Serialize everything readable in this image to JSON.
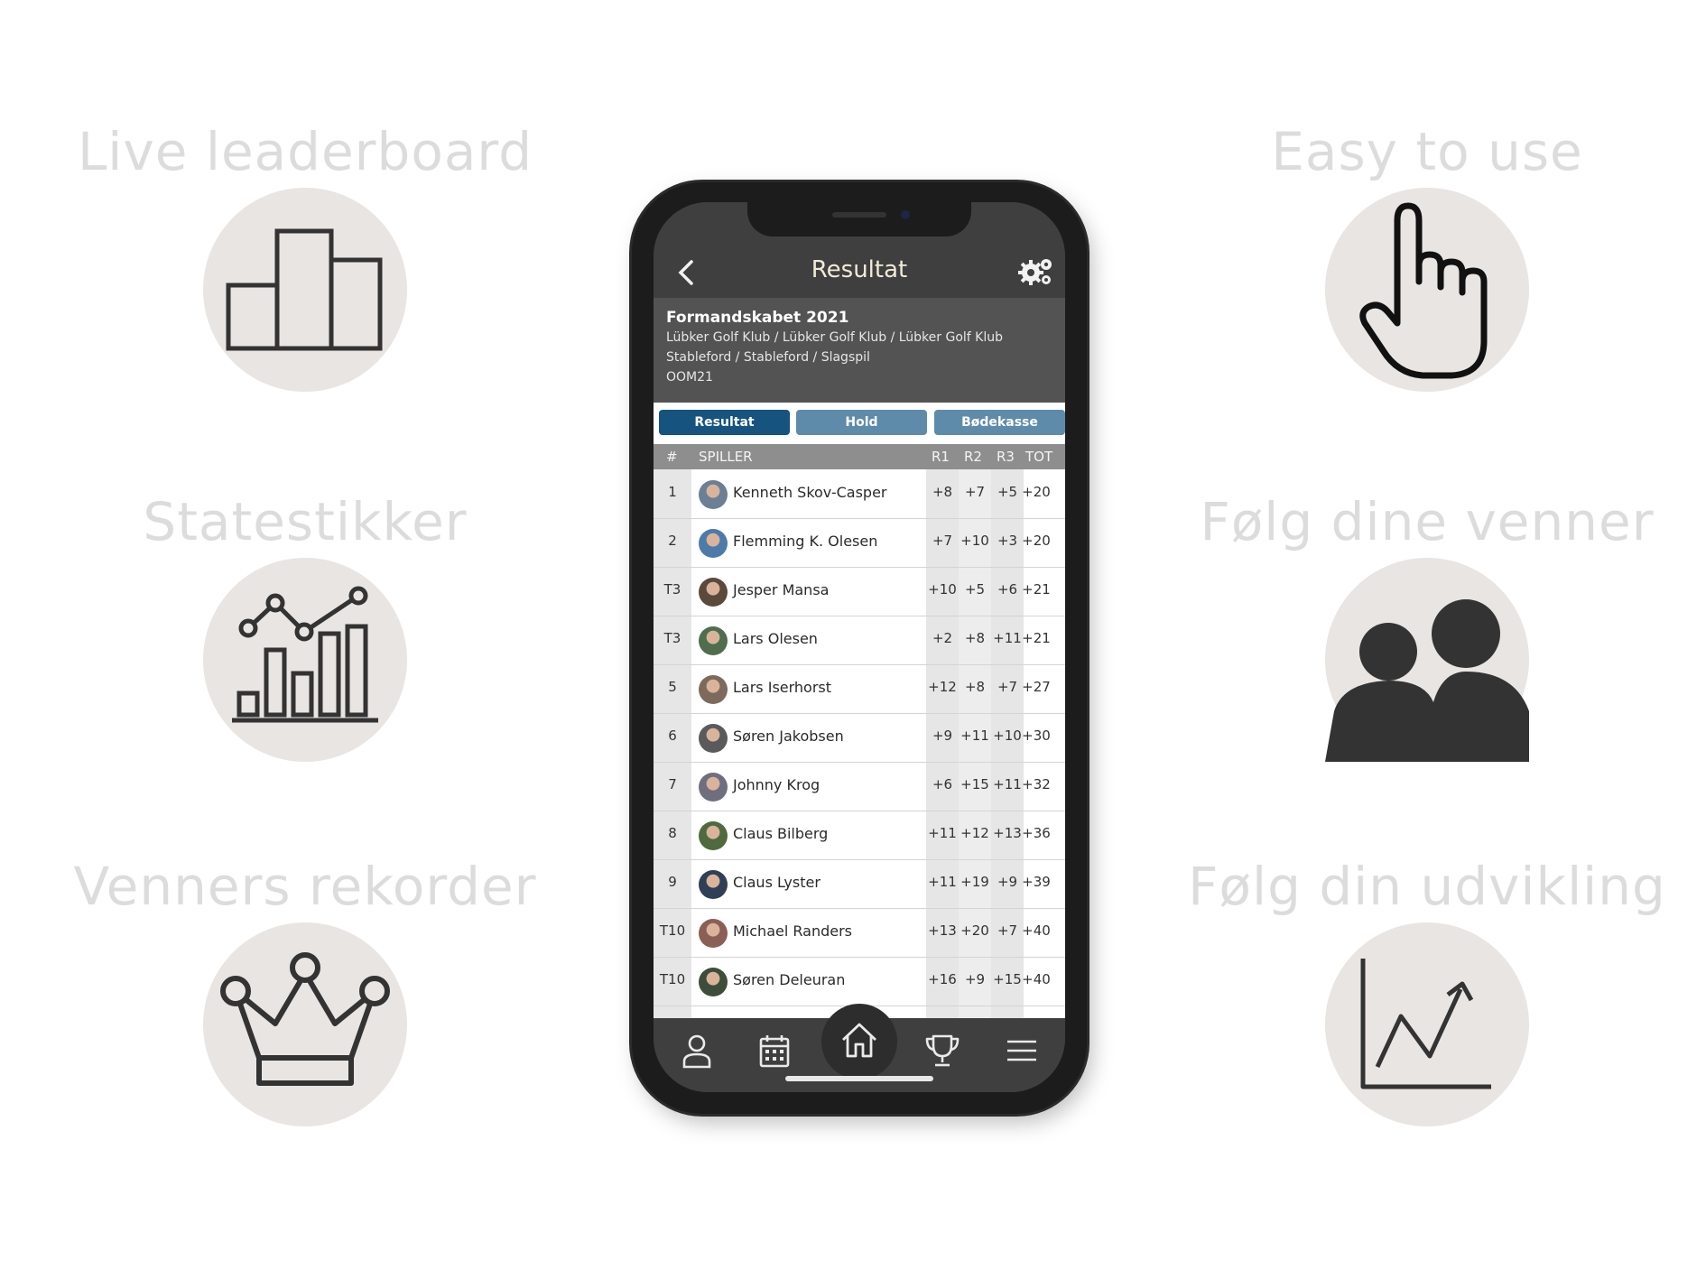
{
  "features": {
    "left": [
      {
        "title": "Live leaderboard",
        "icon": "podium-icon"
      },
      {
        "title": "Statestikker",
        "icon": "bar-line-chart-icon"
      },
      {
        "title": "Venners rekorder",
        "icon": "crown-icon"
      }
    ],
    "right": [
      {
        "title": "Easy to use",
        "icon": "pointing-hand-icon"
      },
      {
        "title": "Følg dine venner",
        "icon": "people-icon"
      },
      {
        "title": "Følg din udvikling",
        "icon": "trend-chart-icon"
      }
    ]
  },
  "app": {
    "title": "Resultat",
    "back_icon": "chevron-left-icon",
    "settings_icon": "gears-icon"
  },
  "event": {
    "name": "Formandskabet 2021",
    "clubs": "Lübker Golf Klub / Lübker Golf Klub / Lübker Golf Klub",
    "formats": "Stableford / Stableford / Slagspil",
    "code": "OOM21"
  },
  "tabs": [
    {
      "label": "Resultat",
      "active": true
    },
    {
      "label": "Hold",
      "active": false
    },
    {
      "label": "Bødekasse",
      "active": false
    }
  ],
  "table": {
    "headers": {
      "pos": "#",
      "player": "SPILLER",
      "r1": "R1",
      "r2": "R2",
      "r3": "R3",
      "tot": "TOT"
    },
    "rows": [
      {
        "pos": "1",
        "name": "Kenneth Skov-Casper",
        "r1": "+8",
        "r2": "+7",
        "r3": "+5",
        "tot": "+20"
      },
      {
        "pos": "2",
        "name": "Flemming K. Olesen",
        "r1": "+7",
        "r2": "+10",
        "r3": "+3",
        "tot": "+20"
      },
      {
        "pos": "T3",
        "name": "Jesper Mansa",
        "r1": "+10",
        "r2": "+5",
        "r3": "+6",
        "tot": "+21"
      },
      {
        "pos": "T3",
        "name": "Lars Olesen",
        "r1": "+2",
        "r2": "+8",
        "r3": "+11",
        "tot": "+21"
      },
      {
        "pos": "5",
        "name": "Lars Iserhorst",
        "r1": "+12",
        "r2": "+8",
        "r3": "+7",
        "tot": "+27"
      },
      {
        "pos": "6",
        "name": "Søren Jakobsen",
        "r1": "+9",
        "r2": "+11",
        "r3": "+10",
        "tot": "+30"
      },
      {
        "pos": "7",
        "name": "Johnny Krog",
        "r1": "+6",
        "r2": "+15",
        "r3": "+11",
        "tot": "+32"
      },
      {
        "pos": "8",
        "name": "Claus Bilberg",
        "r1": "+11",
        "r2": "+12",
        "r3": "+13",
        "tot": "+36"
      },
      {
        "pos": "9",
        "name": "Claus Lyster",
        "r1": "+11",
        "r2": "+19",
        "r3": "+9",
        "tot": "+39"
      },
      {
        "pos": "T10",
        "name": "Michael Randers",
        "r1": "+13",
        "r2": "+20",
        "r3": "+7",
        "tot": "+40"
      },
      {
        "pos": "T10",
        "name": "Søren Deleuran",
        "r1": "+16",
        "r2": "+9",
        "r3": "+15",
        "tot": "+40"
      }
    ]
  },
  "nav": [
    {
      "name": "profile",
      "icon": "person-icon"
    },
    {
      "name": "calendar",
      "icon": "calendar-icon"
    },
    {
      "name": "home",
      "icon": "home-icon"
    },
    {
      "name": "trophy",
      "icon": "trophy-icon"
    },
    {
      "name": "menu",
      "icon": "hamburger-menu-icon"
    }
  ],
  "colors": {
    "screen_bg": "#3f3f3f",
    "tab_active": "#17537f",
    "tab_inactive": "#5f8bab",
    "title_text": "#f2ead7",
    "feature_circle": "#e9e5e3"
  }
}
